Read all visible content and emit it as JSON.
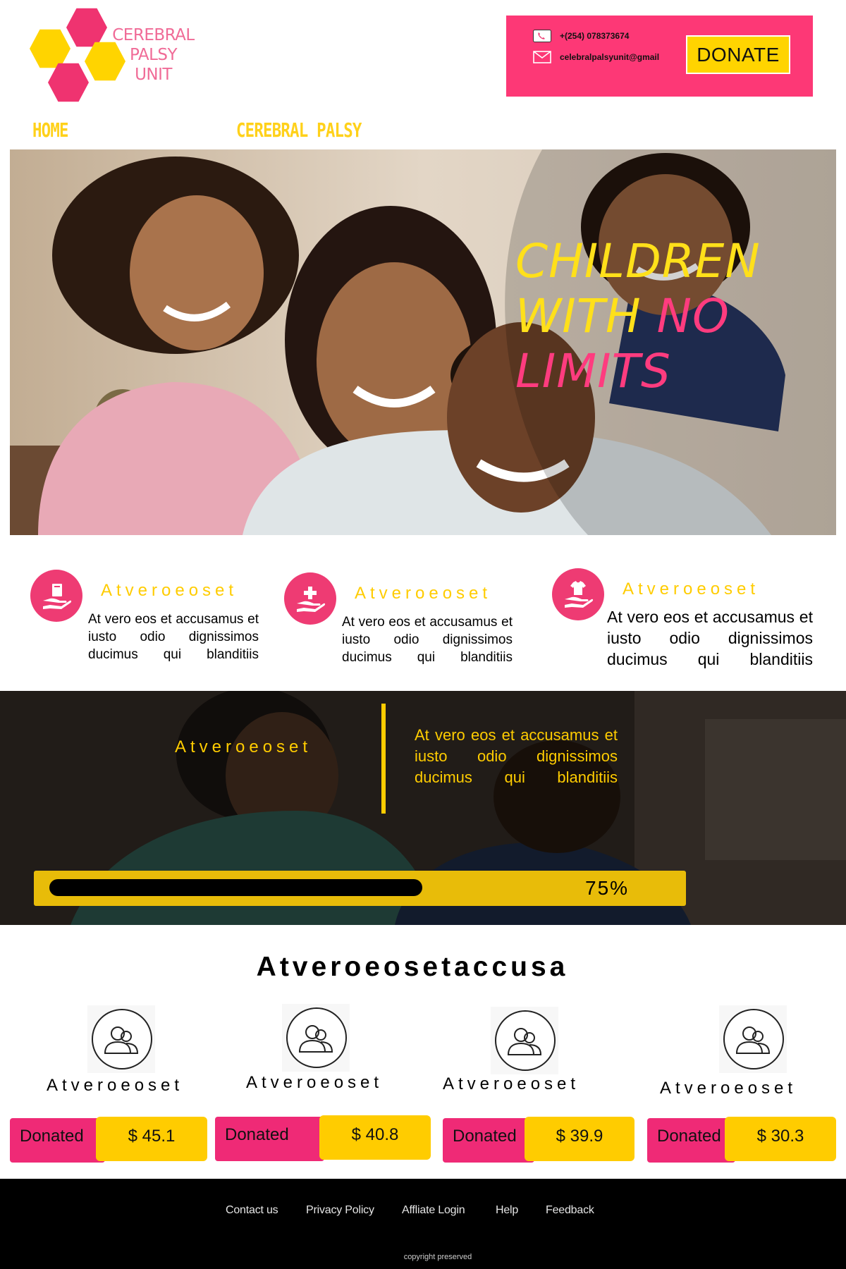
{
  "brand": {
    "logo_line1": "CEREBRAL",
    "logo_line2": "PALSY",
    "logo_line3": "UNIT",
    "pink": "#ef3370",
    "yellow": "#ffd400"
  },
  "contact": {
    "phone": "+(254) 078373674",
    "email": "celebralpalsyunit@gmail",
    "phone_icon": "phone-icon",
    "email_icon": "envelope-icon"
  },
  "donate_button": "DONATE",
  "nav": [
    {
      "label": "HOME"
    },
    {
      "label": "CEREBRAL PALSY"
    }
  ],
  "hero": {
    "title_line1": "CHILDREN",
    "title_line2a": "WITH ",
    "title_line2b": "NO",
    "title_line3": "LIMITS"
  },
  "features": [
    {
      "icon": "book-in-hand-icon",
      "title": "Atveroeoset",
      "body": "At vero eos et accusamus et iusto odio dignissimos ducimus qui blanditiis"
    },
    {
      "icon": "medical-cross-in-hand-icon",
      "title": "Atveroeoset",
      "body": "At vero eos et accusamus et iusto odio dignissimos ducimus qui blanditiis"
    },
    {
      "icon": "shirt-in-hand-icon",
      "title": "Atveroeoset",
      "body": "At vero eos et accusamus et iusto odio dignissimos ducimus qui blanditiis"
    }
  ],
  "mission": {
    "title": "Atveroeoset",
    "body": "At vero eos et accusamus et iusto odio dignissimos ducimus qui blanditiis",
    "progress_label": "75%",
    "progress_fill_fraction": 0.6
  },
  "donors": {
    "heading": "Atveroeosetaccusa",
    "items": [
      {
        "name": "Atveroeoset",
        "label": "Donated",
        "amount": "$ 45.1"
      },
      {
        "name": "Atveroeoset",
        "label": "Donated",
        "amount": "$ 40.8"
      },
      {
        "name": "Atveroeoset",
        "label": "Donated",
        "amount": "$ 39.9"
      },
      {
        "name": "Atveroeoset",
        "label": "Donated",
        "amount": "$ 30.3"
      }
    ]
  },
  "footer": {
    "links": [
      "Contact us",
      "Privacy Policy",
      "Affliate Login",
      "Help",
      "Feedback"
    ],
    "copyright": "copyright preserved"
  }
}
